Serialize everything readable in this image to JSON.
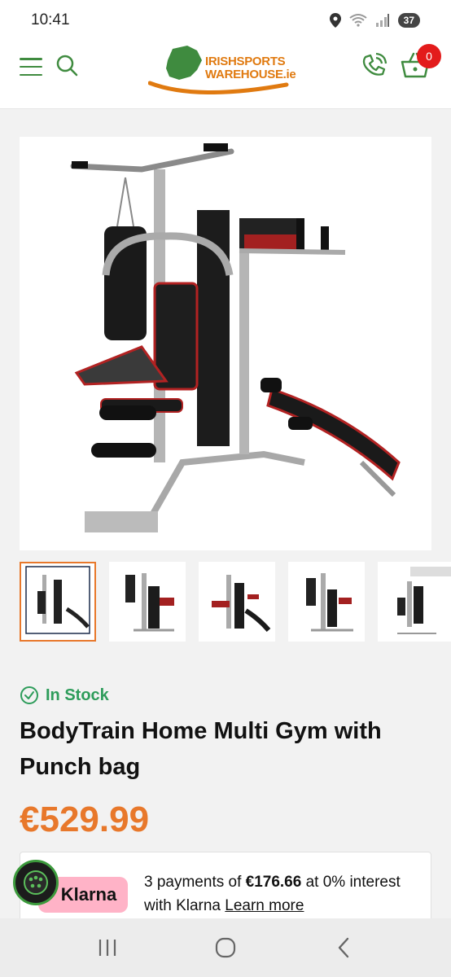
{
  "status_bar": {
    "time": "10:41",
    "battery": "37"
  },
  "header": {
    "logo_line1": "IRISHSPORTS",
    "logo_line2": "WAREHOUSE.ie",
    "cart_count": "0"
  },
  "product": {
    "stock_status": "In Stock",
    "title": "BodyTrain Home Multi Gym with Punch bag",
    "price": "€529.99",
    "thumbnail_count": 5
  },
  "klarna": {
    "logo": "Klarna",
    "text_prefix": "3 payments of ",
    "amount": "€176.66",
    "text_suffix": " at 0% interest with Klarna ",
    "learn_more": "Learn more"
  },
  "colors": {
    "brand_green": "#3f8b3f",
    "accent_orange": "#e8782b",
    "stock_green": "#2d9c5a",
    "badge_red": "#e31b1b",
    "klarna_pink": "#ffb3c7"
  },
  "icons": [
    "menu-icon",
    "search-icon",
    "phone-icon",
    "cart-icon",
    "check-circle-icon",
    "chat-icon",
    "recents-icon",
    "home-icon",
    "back-icon",
    "location-icon",
    "wifi-icon",
    "signal-icon"
  ]
}
